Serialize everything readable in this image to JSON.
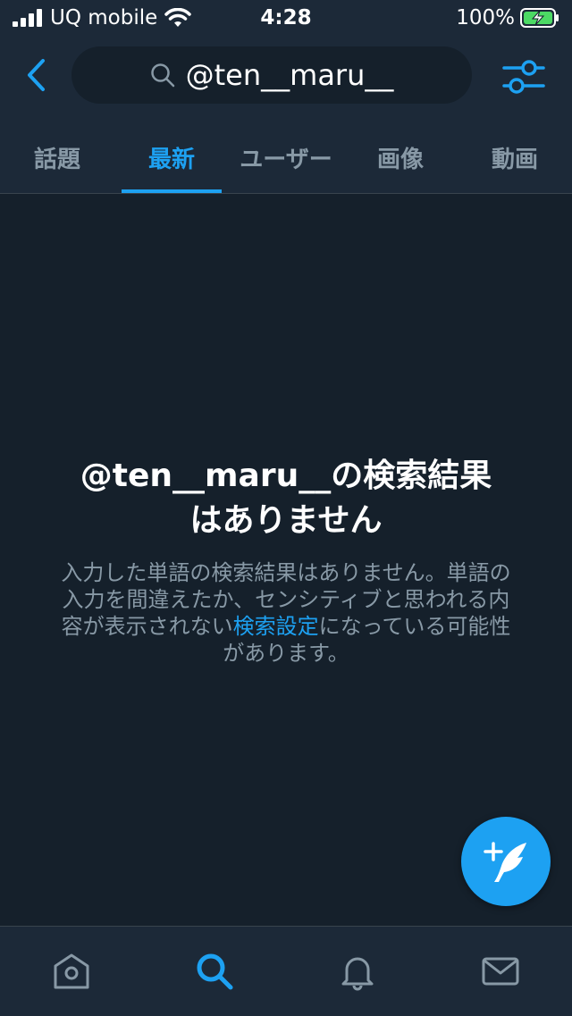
{
  "status": {
    "carrier": "UQ mobile",
    "time": "4:28",
    "battery": "100%"
  },
  "search": {
    "query": "@ten__maru__"
  },
  "tabs": [
    {
      "label": "話題",
      "active": false
    },
    {
      "label": "最新",
      "active": true
    },
    {
      "label": "ユーザー",
      "active": false
    },
    {
      "label": "画像",
      "active": false
    },
    {
      "label": "動画",
      "active": false
    }
  ],
  "empty": {
    "title_line1": "@ten__maru__の検索結果",
    "title_line2": "はありません",
    "desc_before": "入力した単語の検索結果はありません。単語の入力を間違えたか、センシティブと思われる内容が表示されない",
    "desc_link": "検索設定",
    "desc_after": "になっている可能性があります。"
  },
  "icons": {
    "back": "chevron-left-icon",
    "search": "search-icon",
    "filter": "sliders-icon",
    "compose": "compose-tweet-icon",
    "home": "home-icon",
    "explore": "search-icon",
    "notifications": "bell-icon",
    "messages": "mail-icon"
  },
  "colors": {
    "background": "#15202b",
    "bar": "#1c2938",
    "accent": "#1da1f2",
    "muted": "#8899a6",
    "divider": "#38444d"
  }
}
